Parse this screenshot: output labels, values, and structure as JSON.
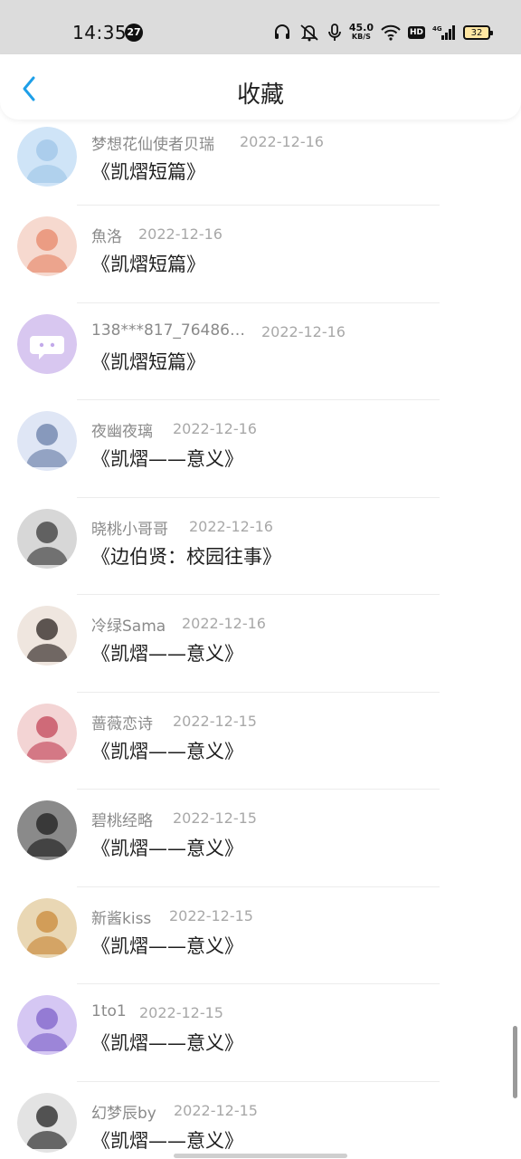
{
  "status_bar": {
    "time": "14:35",
    "badge": "27",
    "speed_value": "45.0",
    "speed_unit": "KB/S",
    "hd_label": "HD",
    "network": "4G",
    "battery": "32",
    "icons": [
      "headphones-icon",
      "silent-icon",
      "microphone-icon",
      "wifi-icon",
      "hd-icon",
      "signal-icon",
      "battery-icon"
    ]
  },
  "header": {
    "title": "收藏",
    "back_icon": "chevron-left-icon",
    "accent_color": "#1e9fe8"
  },
  "favorites": [
    {
      "user": "梦想花仙使者贝瑞",
      "date": "2022-12-16",
      "title": "《凯熠短篇》"
    },
    {
      "user": "魚洛",
      "date": "2022-12-16",
      "title": "《凯熠短篇》"
    },
    {
      "user": "138***817_76486…",
      "date": "2022-12-16",
      "title": "《凯熠短篇》"
    },
    {
      "user": "夜幽夜璃",
      "date": "2022-12-16",
      "title": "《凯熠——意义》"
    },
    {
      "user": "晓桃小哥哥",
      "date": "2022-12-16",
      "title": "《边伯贤：校园往事》"
    },
    {
      "user": "冷绿Sama",
      "date": "2022-12-16",
      "title": "《凯熠——意义》"
    },
    {
      "user": "蔷薇恋诗",
      "date": "2022-12-15",
      "title": "《凯熠——意义》"
    },
    {
      "user": "碧桃经略",
      "date": "2022-12-15",
      "title": "《凯熠——意义》"
    },
    {
      "user": "新酱kiss",
      "date": "2022-12-15",
      "title": "《凯熠——意义》"
    },
    {
      "user": "1to1",
      "date": "2022-12-15",
      "title": "《凯熠——意义》"
    },
    {
      "user": "幻梦辰by",
      "date": "2022-12-15",
      "title": "《凯熠——意义》"
    }
  ]
}
